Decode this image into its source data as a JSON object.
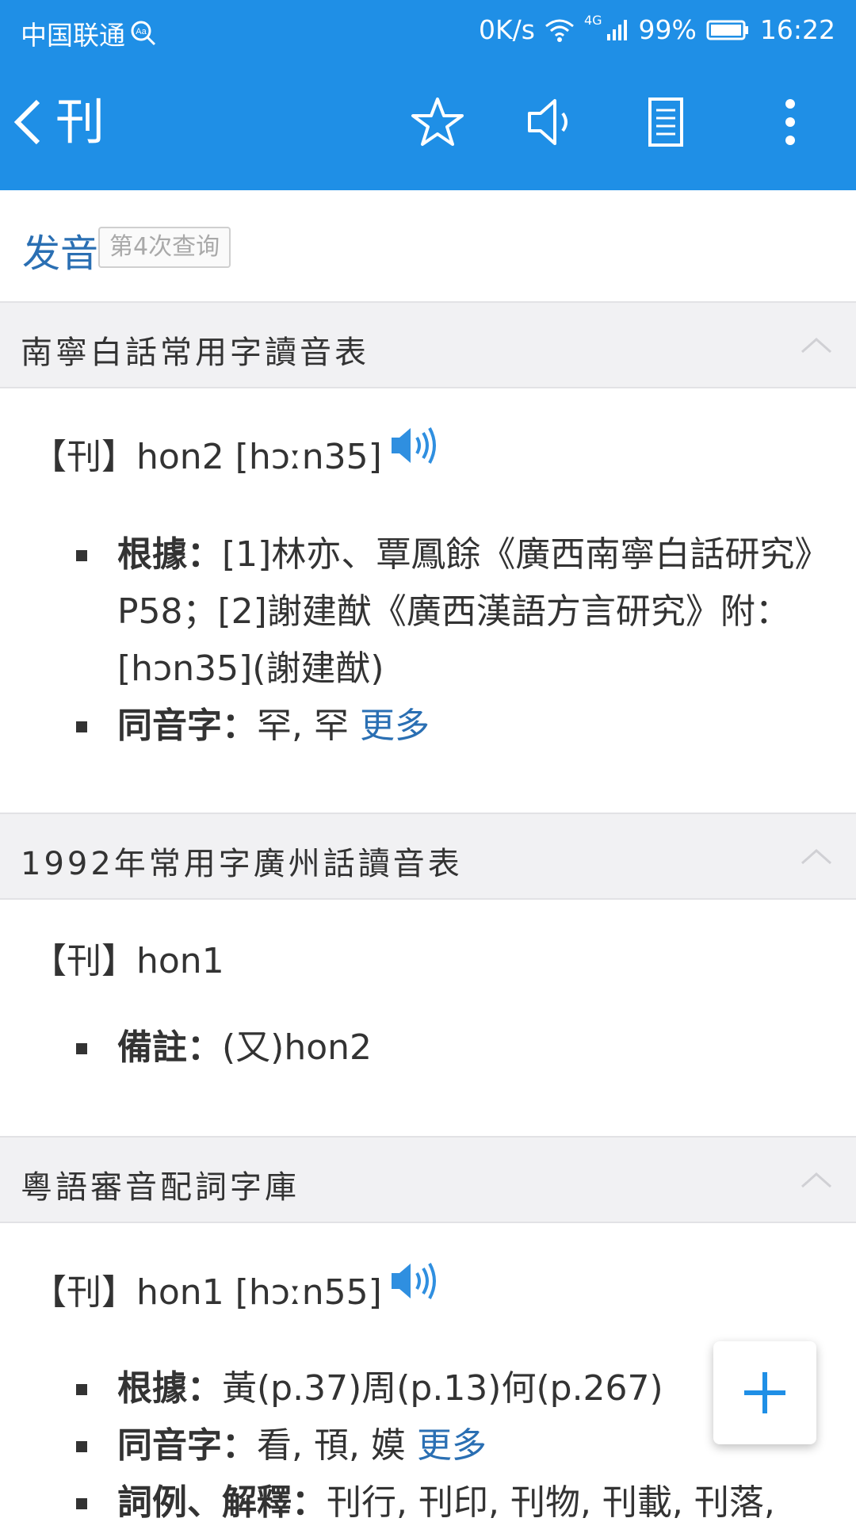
{
  "status_bar": {
    "carrier": "中国联通",
    "net_speed": "0K/s",
    "signal_label": "4G",
    "battery": "99%",
    "time": "16:22"
  },
  "toolbar": {
    "title": "刊",
    "icons": [
      "back-icon",
      "star-icon",
      "speaker-icon",
      "document-icon",
      "more-vertical-icon"
    ]
  },
  "pronunciation": {
    "title": "发音",
    "query_badge": "第4次查询"
  },
  "sections": [
    {
      "title": "南寧白話常用字讀音表",
      "entry": "【刊】hon2 [hɔːn35]",
      "bullets": [
        {
          "label": "根據：",
          "text": "[1]林亦、覃鳳餘《廣西南寧白話研究》P58；[2]謝建猷《廣西漢語方言研究》附：[hɔn35](謝建猷)"
        },
        {
          "label": "同音字：",
          "text": "罕, 罕 ",
          "more": "更多"
        }
      ]
    },
    {
      "title": "1992年常用字廣州話讀音表",
      "entry": "【刊】hon1",
      "bullets": [
        {
          "label": "備註：",
          "text": "(又)hon2"
        }
      ]
    },
    {
      "title": "粵語審音配詞字庫",
      "entry": "【刊】hon1 [hɔːn55]",
      "bullets": [
        {
          "label": "根據：",
          "text": "黃(p.37)周(p.13)何(p.267)"
        },
        {
          "label": "同音字：",
          "text": "看, 頇, 嫫 ",
          "more": "更多"
        },
        {
          "label": "詞例、解釋：",
          "text": "刊行, 刊印, 刊物, 刊載, 刊落,"
        }
      ]
    }
  ],
  "colors": {
    "appbar": "#1f8fe6",
    "link": "#2a6fb3",
    "section_bg": "#f1f1f3"
  }
}
